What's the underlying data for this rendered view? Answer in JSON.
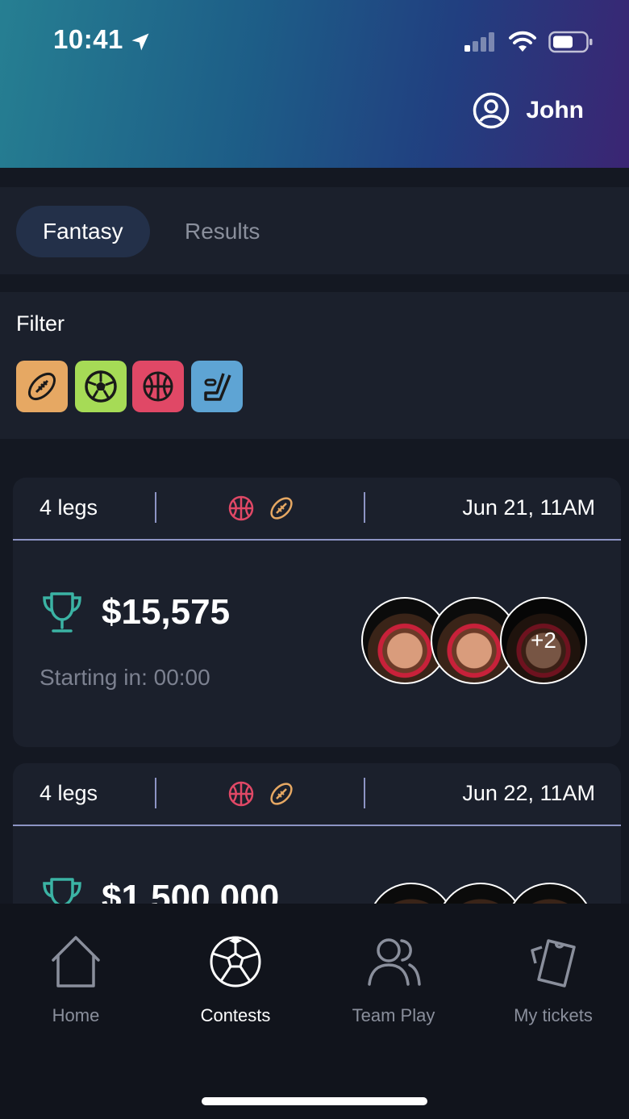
{
  "status_bar": {
    "time": "10:41",
    "icons": [
      "location-arrow-icon",
      "signal-icon",
      "wifi-icon",
      "battery-icon"
    ]
  },
  "header": {
    "user_icon": "user-circle-icon",
    "user_name": "John"
  },
  "tabs": [
    {
      "label": "Fantasy",
      "active": true
    },
    {
      "label": "Results",
      "active": false
    }
  ],
  "filter": {
    "title": "Filter",
    "chips": [
      {
        "icon": "football-icon",
        "color": "#e6a863"
      },
      {
        "icon": "soccer-icon",
        "color": "#a6db56"
      },
      {
        "icon": "basketball-icon",
        "color": "#e04866"
      },
      {
        "icon": "hockey-icon",
        "color": "#5ea4d4"
      }
    ]
  },
  "contests": [
    {
      "legs": "4 legs",
      "sports": [
        "basketball-icon",
        "football-icon"
      ],
      "date": "Jun 21, 11AM",
      "prize": "$15,575",
      "starting": "Starting in: 00:00",
      "more_players": "+2"
    },
    {
      "legs": "4 legs",
      "sports": [
        "basketball-icon",
        "football-icon"
      ],
      "date": "Jun 22, 11AM",
      "prize": "$1,500,000"
    }
  ],
  "nav": [
    {
      "label": "Home",
      "icon": "home-icon",
      "active": false
    },
    {
      "label": "Contests",
      "icon": "soccer-ball-icon",
      "active": true
    },
    {
      "label": "Team Play",
      "icon": "users-icon",
      "active": false
    },
    {
      "label": "My tickets",
      "icon": "ticket-icon",
      "active": false
    }
  ],
  "colors": {
    "accent_teal": "#3bb3a4",
    "basketball": "#e04866",
    "football": "#e6a863",
    "divider": "#8d94c4"
  }
}
